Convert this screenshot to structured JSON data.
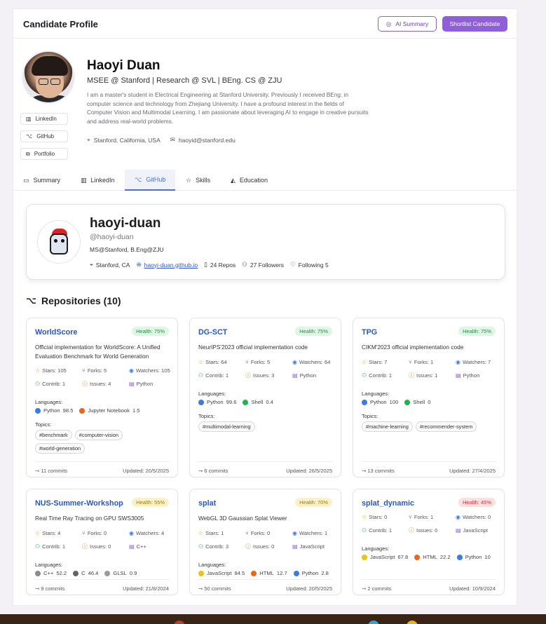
{
  "header": {
    "title": "Candidate Profile",
    "ai_summary": "AI Summary",
    "shortlist": "Shortlist Candidate"
  },
  "profile": {
    "name": "Haoyi Duan",
    "headline": "MSEE @ Stanford | Research @ SVL | BEng. CS @ ZJU",
    "bio": "I am a master's student in Electrical Engineering at Stanford University. Previously I received BEng. in computer science and technology from Zhejiang University. I have a profound interest in the fields of Computer Vision and Multimodal Learning. I am passionate about leveraging AI to engage in creative pursuits and address real-world problems.",
    "location": "Stanford, California, USA",
    "email": "haoyid@stanford.edu",
    "links": [
      "LinkedIn",
      "GitHub",
      "Portfolio"
    ]
  },
  "tabs": [
    "Summary",
    "LinkedIn",
    "GitHub",
    "Skills",
    "Education"
  ],
  "active_tab": "GitHub",
  "github": {
    "login": "haoyi-duan",
    "handle": "@haoyi-duan",
    "bio": "MS@Stanford, B.Eng@ZJU",
    "location": "Stanford, CA",
    "site": "haoyi-duan.github.io",
    "repos": "24 Repos",
    "followers": "27 Followers",
    "following": "Following 5"
  },
  "repos_title": "Repositories (10)",
  "labels": {
    "languages": "Languages:",
    "topics": "Topics:"
  },
  "repos": [
    {
      "name": "WorldScore",
      "health": "Health: 75%",
      "desc": "Official implementation for WorldScore: A Unified Evaluation Benchmark for World Generation",
      "stars": "Stars: 105",
      "forks": "Forks: 5",
      "watchers": "Watchers: 105",
      "contrib": "Contrib: 1",
      "issues": "Issues: 4",
      "lang": "Python",
      "languages": [
        {
          "name": "Python",
          "pct": "98.5",
          "color": "#3c7be0"
        },
        {
          "name": "Jupyter Notebook",
          "pct": "1.5",
          "color": "#e8681b"
        }
      ],
      "topics": [
        "#benchmark",
        "#computer-vision",
        "#world-generation"
      ],
      "commits": "11 commits",
      "updated": "Updated: 20/5/2025"
    },
    {
      "name": "DG-SCT",
      "health": "Health: 75%",
      "desc": "NeurIPS'2023 official implementation code",
      "stars": "Stars: 64",
      "forks": "Forks: 5",
      "watchers": "Watchers: 64",
      "contrib": "Contrib: 1",
      "issues": "Issues: 3",
      "lang": "Python",
      "languages": [
        {
          "name": "Python",
          "pct": "99.6",
          "color": "#3c7be0"
        },
        {
          "name": "Shell",
          "pct": "0.4",
          "color": "#1fb54a"
        }
      ],
      "topics": [
        "#multimodal-learning"
      ],
      "commits": "6 commits",
      "updated": "Updated: 26/5/2025"
    },
    {
      "name": "TPG",
      "health": "Health: 75%",
      "desc": "CIKM'2023 official implementation code",
      "stars": "Stars: 7",
      "forks": "Forks: 1",
      "watchers": "Watchers: 7",
      "contrib": "Contrib: 1",
      "issues": "Issues: 1",
      "lang": "Python",
      "languages": [
        {
          "name": "Python",
          "pct": "100",
          "color": "#3c7be0"
        },
        {
          "name": "Shell",
          "pct": "0",
          "color": "#1fb54a"
        }
      ],
      "topics": [
        "#machine-learning",
        "#recommender-system"
      ],
      "commits": "13 commits",
      "updated": "Updated: 27/4/2025"
    },
    {
      "name": "NUS-Summer-Workshop",
      "health": "Health: 55%",
      "desc": "Real Time Ray Tracing on GPU SWS3005",
      "stars": "Stars: 4",
      "forks": "Forks: 0",
      "watchers": "Watchers: 4",
      "contrib": "Contrib: 1",
      "issues": "Issues: 0",
      "lang": "C++",
      "languages": [
        {
          "name": "C++",
          "pct": "52.2",
          "color": "#8a8a90"
        },
        {
          "name": "C",
          "pct": "46.4",
          "color": "#5f6470"
        },
        {
          "name": "GLSL",
          "pct": "0.9",
          "color": "#9a9aa0"
        }
      ],
      "topics": [],
      "commits": "9 commits",
      "updated": "Updated: 21/8/2024"
    },
    {
      "name": "splat",
      "health": "Health: 70%",
      "desc": "WebGL 3D Gaussian Splat Viewer",
      "stars": "Stars: 1",
      "forks": "Forks: 0",
      "watchers": "Watchers: 1",
      "contrib": "Contrib: 3",
      "issues": "Issues: 0",
      "lang": "JavaScript",
      "languages": [
        {
          "name": "JavaScript",
          "pct": "84.5",
          "color": "#e6c41a"
        },
        {
          "name": "HTML",
          "pct": "12.7",
          "color": "#e8681b"
        },
        {
          "name": "Python",
          "pct": "2.8",
          "color": "#3c7be0"
        }
      ],
      "topics": [],
      "commits": "50 commits",
      "updated": "Updated: 20/5/2025"
    },
    {
      "name": "splat_dynamic",
      "health": "Health: 45%",
      "desc": "",
      "stars": "Stars: 0",
      "forks": "Forks: 1",
      "watchers": "Watchers: 0",
      "contrib": "Contrib: 1",
      "issues": "Issues: 0",
      "lang": "JavaScript",
      "languages": [
        {
          "name": "JavaScript",
          "pct": "67.8",
          "color": "#e6c41a"
        },
        {
          "name": "HTML",
          "pct": "22.2",
          "color": "#e8681b"
        },
        {
          "name": "Python",
          "pct": "10",
          "color": "#3c7be0"
        }
      ],
      "topics": [],
      "commits": "2 commits",
      "updated": "Updated: 10/9/2024"
    }
  ]
}
